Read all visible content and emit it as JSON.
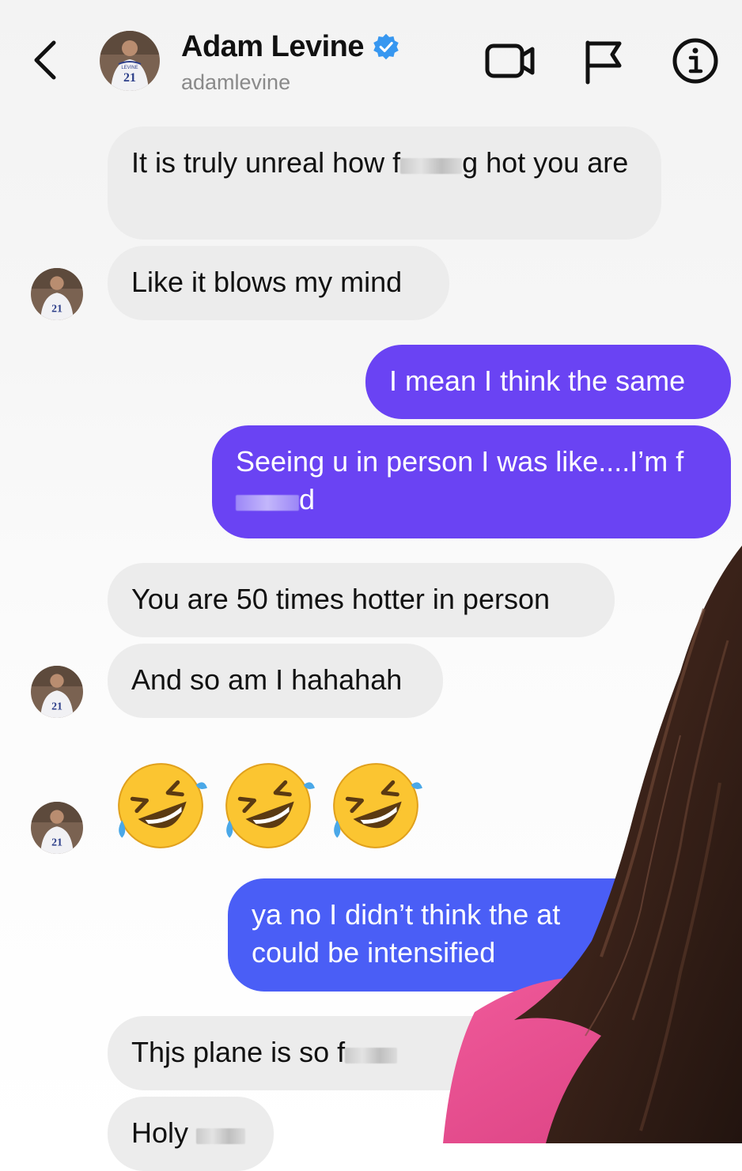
{
  "header": {
    "contact_name": "Adam Levine",
    "handle": "adamlevine",
    "avatar_jersey_number": "21",
    "avatar_jersey_name": "LEVINE"
  },
  "icons": {
    "back": "chevron-left-icon",
    "verified": "verified-badge-icon",
    "video": "video-camera-icon",
    "flag": "flag-icon",
    "info": "info-icon"
  },
  "colors": {
    "outgoing_purple": "#6a43f3",
    "outgoing_blue": "#4a5ef6",
    "incoming_gray": "#ececec",
    "verified_blue": "#3797f0"
  },
  "messages": [
    {
      "from": "them",
      "pre": "It is truly unreal how f",
      "post": "g hot you are"
    },
    {
      "from": "them",
      "text": "Like it blows my mind"
    },
    {
      "from": "me",
      "text": "I mean I think the same"
    },
    {
      "from": "me",
      "pre": "Seeing u in person I was like....I’m f",
      "post": "d"
    },
    {
      "from": "them",
      "text": "You are 50 times hotter in person"
    },
    {
      "from": "them",
      "text": "And so am I hahahah"
    },
    {
      "from": "them",
      "type": "emoji",
      "emoji": "🤣🤣🤣"
    },
    {
      "from": "me",
      "line1": "ya no I didn’t think the at",
      "line2": "could be intensified"
    },
    {
      "from": "them",
      "pre": "Thjs plane is so f"
    },
    {
      "from": "them",
      "pre": "Holy "
    }
  ]
}
